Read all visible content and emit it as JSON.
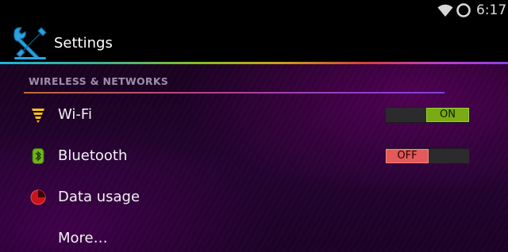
{
  "status_bar": {
    "time": "6:17",
    "icons": [
      "wifi-signal-icon",
      "battery-icon"
    ]
  },
  "action_bar": {
    "title": "Settings",
    "icon": "settings-tools-icon",
    "divider_colors": [
      "#1fb3d8",
      "#7fbf2a",
      "#c8a11a",
      "#d5433a",
      "#b63fd2"
    ]
  },
  "section": {
    "header": "WIRELESS & NETWORKS"
  },
  "items": [
    {
      "label": "Wi-Fi",
      "icon": "wifi-icon",
      "toggle": "ON",
      "toggle_color": "#7aab12"
    },
    {
      "label": "Bluetooth",
      "icon": "bluetooth-icon",
      "toggle": "OFF",
      "toggle_color": "#e25a5a"
    },
    {
      "label": "Data usage",
      "icon": "data-usage-icon"
    },
    {
      "label": "More…"
    }
  ]
}
